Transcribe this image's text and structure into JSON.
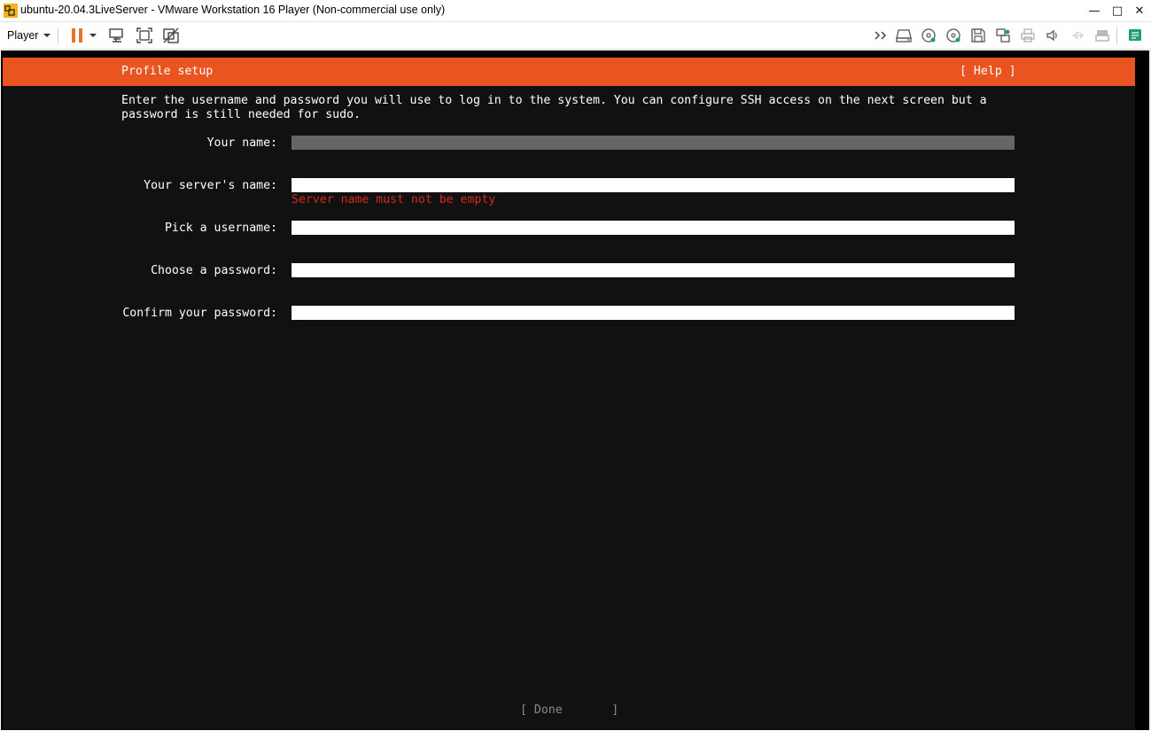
{
  "window": {
    "title": "ubuntu-20.04.3LiveServer - VMware Workstation 16 Player (Non-commercial use only)",
    "minimize": "—",
    "maximize": "□",
    "close": "✕"
  },
  "toolbar": {
    "player_label": "Player",
    "icons": [
      "pause-icon",
      "pause-dropdown-icon",
      "send-ctrl-alt-del-icon",
      "full-screen-icon",
      "unity-icon",
      "more-icon",
      "hard-disk-icon",
      "cd-dvd-icon",
      "cd-dvd-2-icon",
      "floppy-icon",
      "network-adapter-icon",
      "printer-icon",
      "sound-card-icon",
      "usb-icon",
      "display-icon",
      "message-log-icon"
    ],
    "colors": {
      "pause": "#E8732A",
      "accent_green": "#1E9E7A"
    }
  },
  "installer": {
    "header_title": "Profile setup",
    "help_label": "[ Help ]",
    "intro_line1": "Enter the username and password you will use to log in to the system. You can configure SSH access on the next screen but a",
    "intro_line2": "password is still needed for sudo.",
    "fields": {
      "your_name": {
        "label": "Your name:",
        "value": ""
      },
      "server_name": {
        "label": "Your server's name:",
        "value": "",
        "error": "Server name must not be empty"
      },
      "username": {
        "label": "Pick a username:",
        "value": ""
      },
      "password": {
        "label": "Choose a password:",
        "value": ""
      },
      "confirm_password": {
        "label": "Confirm your password:",
        "value": ""
      }
    },
    "done_label": "[ Done       ]",
    "colors": {
      "header": "#E95420",
      "background": "#111111",
      "error": "#D22A1E"
    }
  }
}
